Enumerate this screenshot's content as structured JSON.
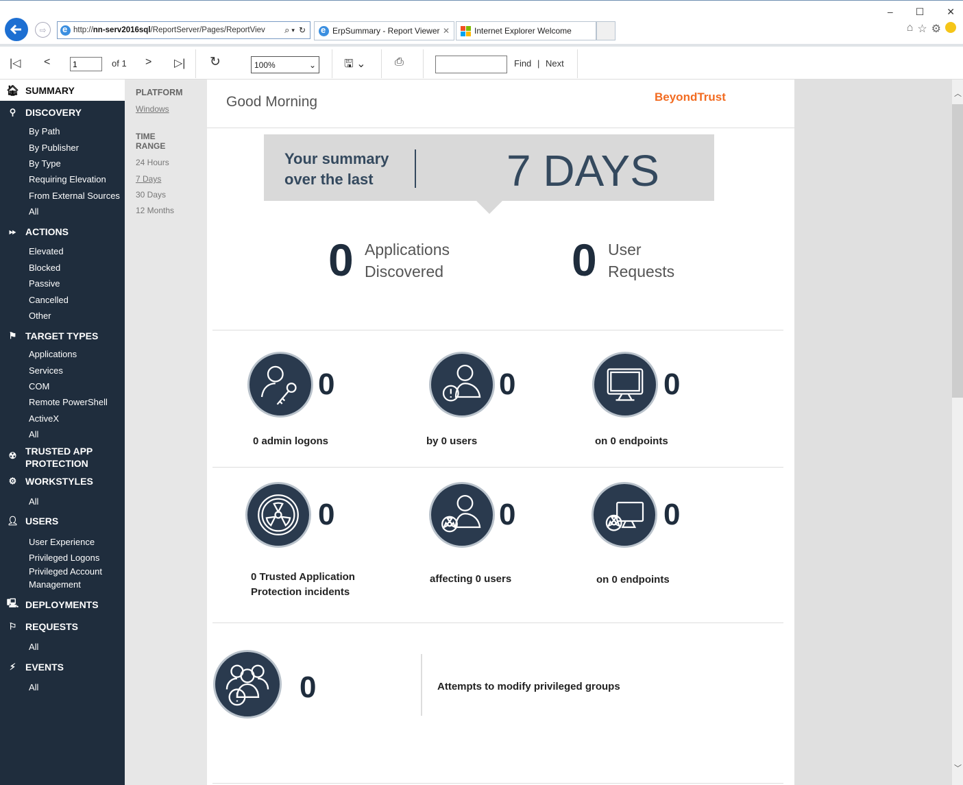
{
  "browser": {
    "url_prefix": "http://",
    "url_host": "nn-serv2016sql",
    "url_path": "/ReportServer/Pages/ReportViev",
    "tab_active": "ErpSummary - Report Viewer",
    "tab_other": "Internet Explorer Welcome",
    "colors": {
      "back_button": "#1d6fd2"
    }
  },
  "toolbar": {
    "page_value": "1",
    "of_label": "of 1",
    "zoom": "100%",
    "find_label": "Find",
    "separator": "|",
    "next_label": "Next"
  },
  "sidebar": {
    "summary": "SUMMARY",
    "discovery": "DISCOVERY",
    "discovery_items": [
      "By Path",
      "By Publisher",
      "By Type",
      "Requiring Elevation",
      "From External Sources",
      "All"
    ],
    "actions": "ACTIONS",
    "actions_items": [
      "Elevated",
      "Blocked",
      "Passive",
      "Cancelled",
      "Other"
    ],
    "target_types": "TARGET TYPES",
    "target_items": [
      "Applications",
      "Services",
      "COM",
      "Remote PowerShell",
      "ActiveX",
      "All"
    ],
    "trusted_line1": "TRUSTED APP",
    "trusted_line2": "PROTECTION",
    "workstyles": "WORKSTYLES",
    "workstyles_items": [
      "All"
    ],
    "users": "USERS",
    "users_items": [
      "User Experience",
      "Privileged Logons",
      "Privileged Account",
      "Management"
    ],
    "deployments": "DEPLOYMENTS",
    "requests": "REQUESTS",
    "requests_items": [
      "All"
    ],
    "events": "EVENTS",
    "events_items": [
      "All"
    ],
    "colors": {
      "background": "#1f2d3d"
    }
  },
  "filters": {
    "platform_label": "PLATFORM",
    "platform_value": "Windows",
    "time_label_1": "TIME",
    "time_label_2": "RANGE",
    "time_options": [
      "24 Hours",
      "7 Days",
      "30 Days",
      "12 Months"
    ]
  },
  "report": {
    "greeting": "Good Morning",
    "brand": "BeyondTrust",
    "banner_line1": "Your summary",
    "banner_line2": "over the last",
    "banner_days": "7 DAYS",
    "apps_count": "0",
    "apps_line1": "Applications",
    "apps_line2": "Discovered",
    "requests_count": "0",
    "requests_line1": "User",
    "requests_line2": "Requests",
    "row1": [
      {
        "count": "0",
        "caption": "0 admin logons"
      },
      {
        "count": "0",
        "caption": "by 0 users"
      },
      {
        "count": "0",
        "caption": "on 0 endpoints"
      }
    ],
    "row2": [
      {
        "count": "0",
        "caption_line1": "0 Trusted Application",
        "caption_line2": "Protection incidents"
      },
      {
        "count": "0",
        "caption_line1": "affecting 0 users"
      },
      {
        "count": "0",
        "caption_line1": "on 0 endpoints"
      }
    ],
    "groups_count": "0",
    "groups_caption": "Attempts to modify privileged groups",
    "colors": {
      "brand": "#f26b21",
      "icon_circle": "#2a3a4e",
      "number": "#1f2d3d"
    }
  }
}
